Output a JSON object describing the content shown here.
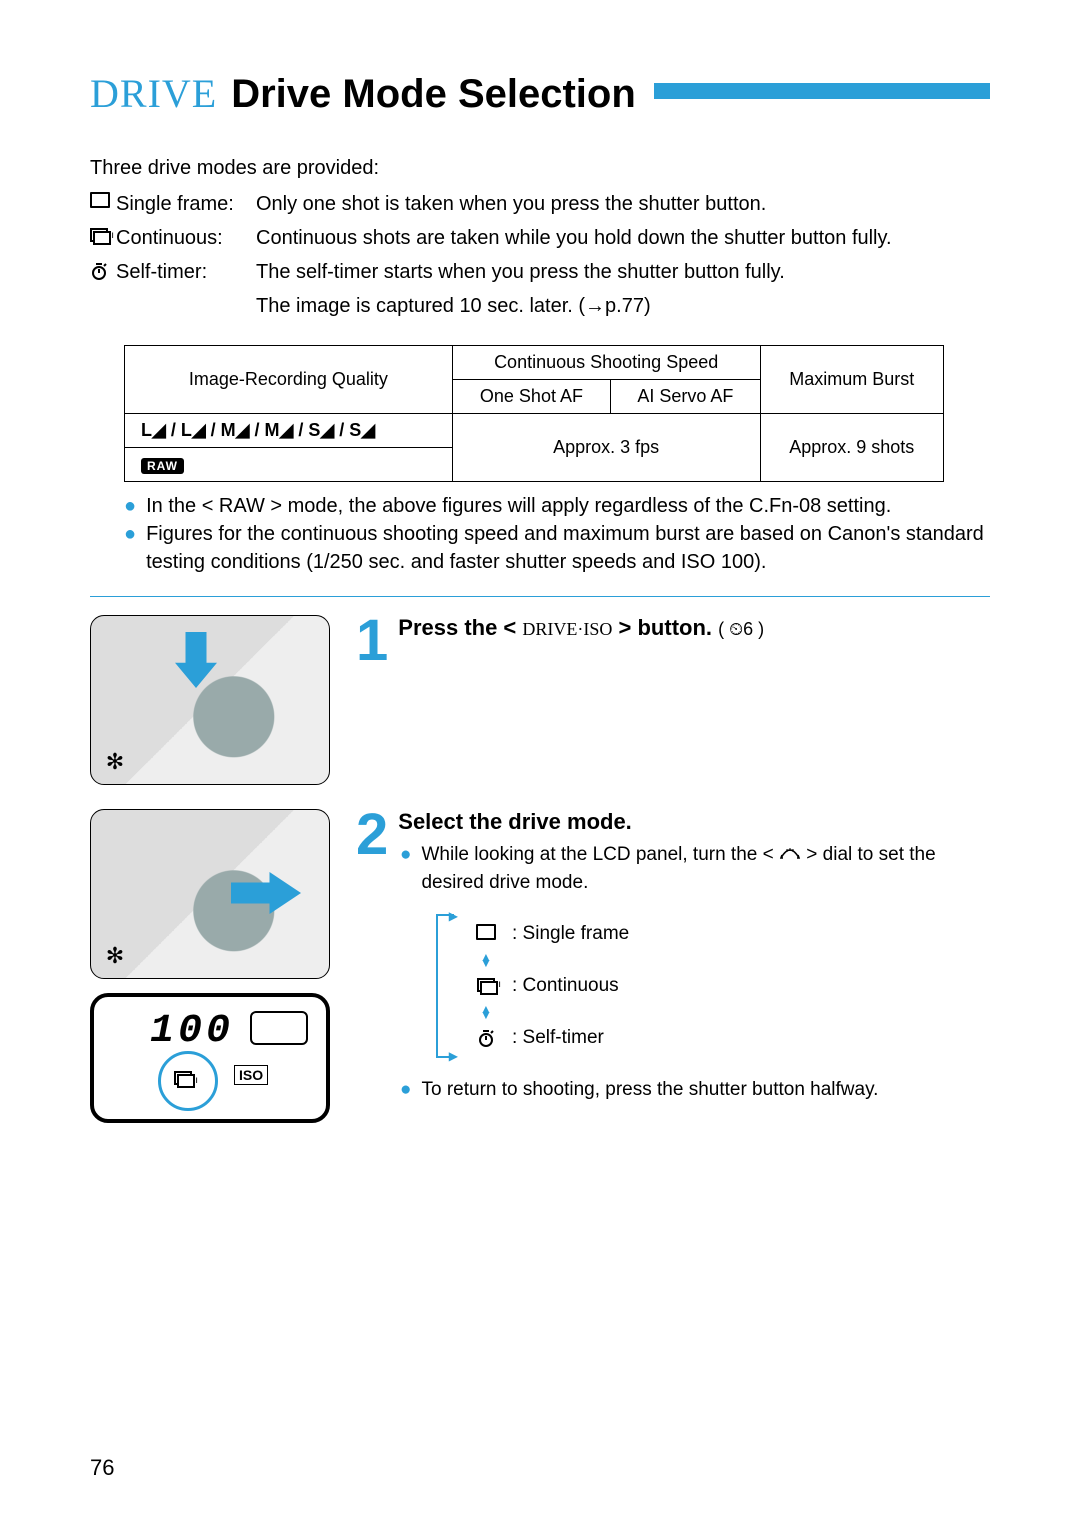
{
  "title": {
    "prefix": "DRIVE",
    "main": "Drive Mode Selection"
  },
  "intro": "Three drive modes are provided:",
  "modes": [
    {
      "icon": "single-frame-icon",
      "label": "Single frame:",
      "desc": "Only one shot is taken when you press the shutter button."
    },
    {
      "icon": "continuous-icon",
      "label": "Continuous:",
      "desc": "Continuous shots are taken while you hold down the shutter button fully."
    },
    {
      "icon": "self-timer-icon",
      "label": "Self-timer:",
      "desc": "The self-timer starts when you press the shutter button fully.",
      "desc2": "The image is captured 10 sec. later. (→p.77)"
    }
  ],
  "table": {
    "headers": {
      "quality": "Image-Recording Quality",
      "speed": "Continuous Shooting Speed",
      "one_shot": "One Shot AF",
      "ai_servo": "AI Servo AF",
      "burst": "Maximum Burst"
    },
    "rows": {
      "quality_jpeg": "L◢ / L◢ / M◢ / M◢ / S◢ / S◢",
      "quality_raw": "RAW",
      "speed": "Approx. 3 fps",
      "burst": "Approx. 9 shots"
    }
  },
  "notes": [
    "In the < RAW > mode, the above figures will apply regardless of the C.Fn-08 setting.",
    "Figures for the continuous shooting speed and maximum burst are based on Canon's standard testing conditions (1/250 sec. and faster shutter speeds and ISO 100)."
  ],
  "steps": {
    "s1": {
      "num": "1",
      "head_pre": "Press the <",
      "head_mid": "DRIVE·ISO",
      "head_post": "> button.",
      "timer": "( ⏲6 )"
    },
    "s2": {
      "num": "2",
      "head": "Select the drive mode.",
      "bullet1_pre": "While looking at the LCD panel, turn the <",
      "bullet1_post": "> dial to set the desired drive mode.",
      "options": [
        {
          "icon": "single-frame-icon",
          "text": ": Single frame"
        },
        {
          "icon": "continuous-icon",
          "text": ": Continuous"
        },
        {
          "icon": "self-timer-icon",
          "text": ": Self-timer"
        }
      ],
      "bullet2": "To return to shooting, press the shutter button halfway."
    }
  },
  "lcd": {
    "value": "100",
    "iso": "ISO"
  },
  "page_number": "76"
}
